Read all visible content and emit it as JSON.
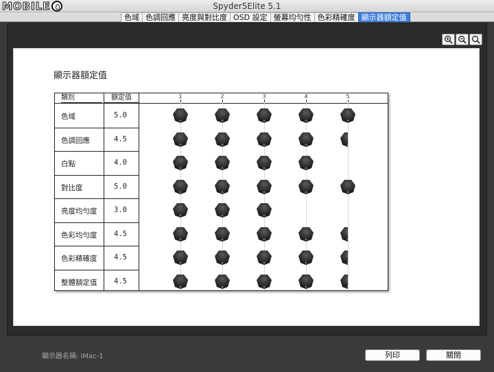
{
  "window": {
    "title": "Spyder5Elite 5.1"
  },
  "logo": {
    "text": "MOBILE"
  },
  "tabs": [
    {
      "label": "色域",
      "active": false
    },
    {
      "label": "色調回應",
      "active": false
    },
    {
      "label": "亮度與對比度",
      "active": false
    },
    {
      "label": "OSD 設定",
      "active": false
    },
    {
      "label": "螢幕均勻性",
      "active": false
    },
    {
      "label": "色彩精確度",
      "active": false
    },
    {
      "label": "顯示器額定值",
      "active": true
    }
  ],
  "zoom": {
    "icons": [
      "zoom-in-icon",
      "zoom-out-icon",
      "zoom-fit-icon"
    ]
  },
  "report": {
    "heading": "顯示器額定值",
    "columns": {
      "category": "類別",
      "rating": "額定值",
      "scale": [
        "1",
        "2",
        "3",
        "4",
        "5"
      ]
    },
    "rows": [
      {
        "category": "色域",
        "rating": "5.0",
        "value": 5.0
      },
      {
        "category": "色調回應",
        "rating": "4.5",
        "value": 4.5
      },
      {
        "category": "白點",
        "rating": "4.0",
        "value": 4.0
      },
      {
        "category": "對比度",
        "rating": "5.0",
        "value": 5.0
      },
      {
        "category": "亮度均勻度",
        "rating": "3.0",
        "value": 3.0
      },
      {
        "category": "色彩均勻度",
        "rating": "4.5",
        "value": 4.5
      },
      {
        "category": "色彩精確度",
        "rating": "4.5",
        "value": 4.5
      },
      {
        "category": "整體額定值",
        "rating": "4.5",
        "value": 4.5
      }
    ]
  },
  "footer": {
    "display_name": "顯示器名稱: iMac-1",
    "print_label": "列印",
    "close_label": "關閉"
  },
  "colors": {
    "active_tab": "#3b7de0",
    "frame": "#2b2b2b",
    "puck": "#1f1f1f"
  }
}
